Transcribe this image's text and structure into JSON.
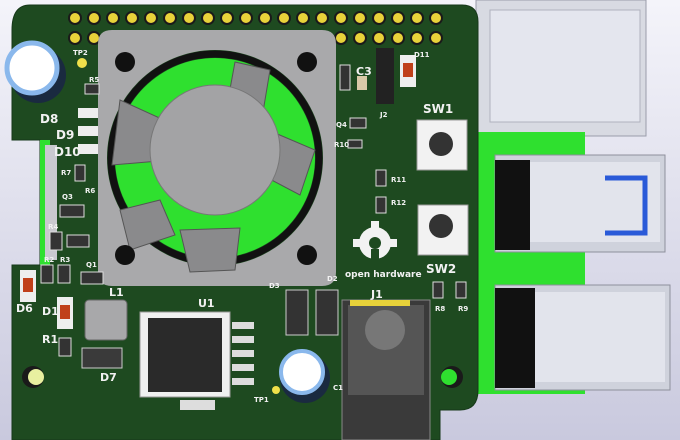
{
  "viewer": {
    "subject": "PCB 3D render"
  },
  "silkscreen": {
    "labels": {
      "tp2": "TP2",
      "r5": "R5",
      "d8": "D8",
      "d9": "D9",
      "d10": "D10",
      "r7": "R7",
      "r6": "R6",
      "q3": "Q3",
      "r4": "R4",
      "r2": "R2",
      "r3": "R3",
      "q1": "Q1",
      "d6": "D6",
      "d1": "D1",
      "r1": "R1",
      "l1": "L1",
      "d7": "D7",
      "u1": "U1",
      "d3": "D3",
      "d2": "D2",
      "j1": "J1",
      "c3": "C3",
      "d11": "D11",
      "j2": "J2",
      "q4": "Q4",
      "r10": "R10",
      "r11": "R11",
      "r12": "R12",
      "sw1": "SW1",
      "sw2": "SW2",
      "r8": "R8",
      "r9": "R9",
      "tp1": "TP1",
      "c1": "C1"
    },
    "logo_text": "open hardware"
  },
  "colors": {
    "board": "#1e4a20",
    "copper_fill": "#2fe02f",
    "pads": "#e8d23a",
    "silk": "#f2f2f2"
  }
}
